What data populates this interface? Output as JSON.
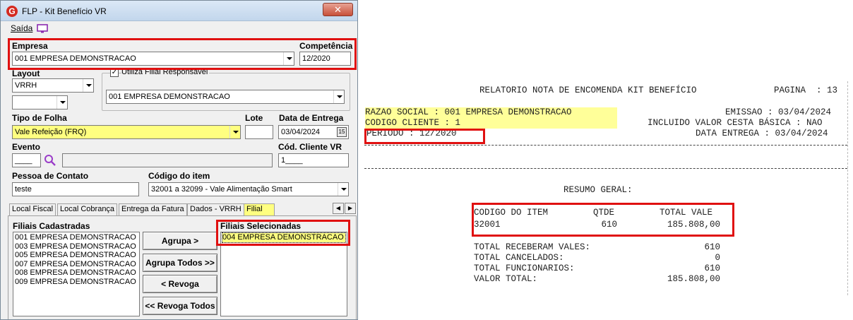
{
  "window": {
    "title": "FLP - Kit Benefício VR",
    "close_label": "✕",
    "menu": {
      "saida": "Saída"
    }
  },
  "form": {
    "empresa": {
      "label": "Empresa",
      "value": "001 EMPRESA DEMONSTRACAO"
    },
    "competencia": {
      "label": "Competência",
      "value": "12/2020"
    },
    "layout": {
      "label": "Layout",
      "value": "VRRH",
      "second_value": ""
    },
    "utiliza_filial": {
      "label": "Utiliza Filial Responsável",
      "checked": true,
      "value": "001 EMPRESA DEMONSTRACAO"
    },
    "tipo_folha": {
      "label": "Tipo de Folha",
      "value": "Vale Refeição (FRQ)"
    },
    "lote": {
      "label": "Lote",
      "value": ""
    },
    "data_entrega": {
      "label": "Data de Entrega",
      "value": "03/04/2024",
      "cal_label": "15"
    },
    "evento": {
      "label": "Evento",
      "code": "____",
      "desc": ""
    },
    "cod_cliente": {
      "label": "Cód. Cliente VR",
      "value": "1____"
    },
    "pessoa_contato": {
      "label": "Pessoa de Contato",
      "value": "teste"
    },
    "codigo_item": {
      "label": "Código do item",
      "value": "32001 a 32099 - Vale Alimentação Smart"
    }
  },
  "tabs": [
    {
      "label": "Local Fiscal"
    },
    {
      "label": "Local Cobrança"
    },
    {
      "label": "Entrega da Fatura"
    },
    {
      "label": "Dados - VRRH"
    },
    {
      "label": "Filial"
    }
  ],
  "tab_scroll": {
    "left": "◀",
    "right": "▶"
  },
  "filiais": {
    "cadastradas_label": "Filiais Cadastradas",
    "cadastradas": [
      "001 EMPRESA DEMONSTRACAO",
      "003 EMPRESA DEMONSTRACAO",
      "005 EMPRESA DEMONSTRACAO",
      "007 EMPRESA DEMONSTRACAO",
      "008 EMPRESA DEMONSTRACAO",
      "009 EMPRESA DEMONSTRACAO"
    ],
    "selecionadas_label": "Filiais Selecionadas",
    "selecionadas": [
      "004 EMPRESA DEMONSTRACAO"
    ]
  },
  "buttons": {
    "agrupa": "Agrupa >",
    "agrupa_todos": "Agrupa Todos >>",
    "revoga": "< Revoga",
    "revoga_todos": "<< Revoga Todos"
  },
  "report": {
    "title": "RELATORIO NOTA DE ENCOMENDA KIT BENEFÍCIO",
    "pagina": "PAGINA  : 13",
    "razao_social": "RAZAO SOCIAL : 001 EMPRESA DEMONSTRACAO",
    "emissao": "EMISSAO : 03/04/2024",
    "codigo_cliente": "CODIGO CLIENTE : 1",
    "incluido_cesta": "INCLUIDO VALOR CESTA BÁSICA : NAO",
    "periodo": "PERIODO : 12/2020",
    "data_entrega": "DATA ENTREGA : 03/04/2024",
    "resumo_geral": "RESUMO GERAL:",
    "table_header": {
      "item": "CODIGO DO ITEM",
      "qtde": "QTDE",
      "total": "TOTAL VALE"
    },
    "table_row": {
      "item": "32001",
      "qtde": "610",
      "total": "185.808,00"
    },
    "totals": [
      {
        "label": "TOTAL RECEBERAM VALES:",
        "value": "610"
      },
      {
        "label": "TOTAL CANCELADOS:",
        "value": "0"
      },
      {
        "label": "TOTAL FUNCIONARIOS:",
        "value": "610"
      },
      {
        "label": "VALOR TOTAL:",
        "value": "185.808,00"
      }
    ]
  }
}
